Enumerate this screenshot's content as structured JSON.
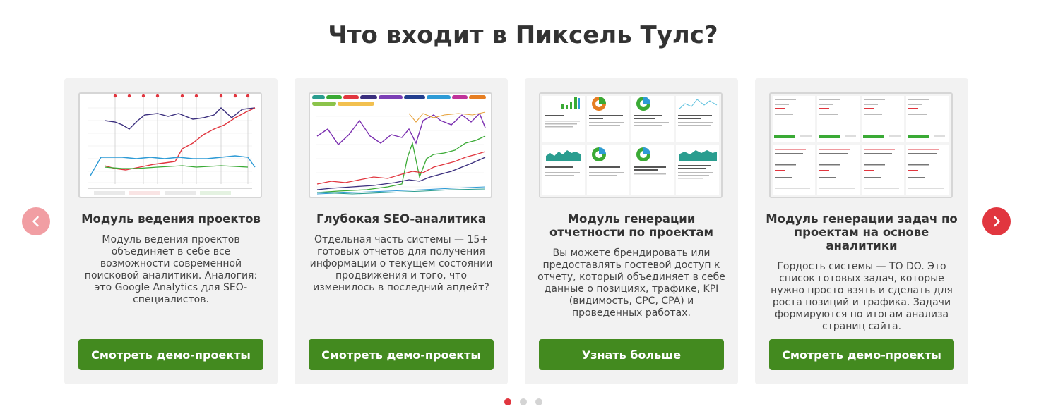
{
  "title": "Что входит в Пиксель Тулс?",
  "accent_color": "#438a1f",
  "nav": {
    "prev_icon": "chevron-left-icon",
    "next_icon": "chevron-right-icon",
    "prev_color": "#f19ea3",
    "next_color": "#e1363f"
  },
  "cards": [
    {
      "title": "Модуль ведения проектов",
      "description": "Модуль ведения проектов объединяет в себе все возможности современной поисковой аналитики. Аналогия: это Google Analytics для SEO-специалистов.",
      "button": "Смотреть демо-проекты",
      "preview": "line-chart-preview"
    },
    {
      "title": "Глубокая SEO-аналитика",
      "description": "Отдельная часть системы — 15+ готовых отчетов для получения информации о текущем состоянии продвижения и того, что изменилось в последний апдейт?",
      "button": "Смотреть демо-проекты",
      "preview": "multi-series-chart-preview"
    },
    {
      "title": "Модуль генерации отчетности по проектам",
      "description": "Вы можете брендировать или предоставлять гостевой доступ к отчету, который объединяет в себе данные о позициях, трафике, KPI (видимость, CPC, CPA) и проведенных работах.",
      "button": "Узнать больше",
      "preview": "report-dashboard-preview"
    },
    {
      "title": "Модуль генерации задач по проектам на основе аналитики",
      "description": "Гордость системы — TO DO. Это список готовых задач, которые нужно просто взять и сделать для роста позиций и трафика. Задачи формируются по итогам анализа страниц сайта.",
      "button": "Смотреть демо-проекты",
      "preview": "task-board-preview"
    }
  ],
  "pagination": {
    "total": 3,
    "active": 1
  }
}
